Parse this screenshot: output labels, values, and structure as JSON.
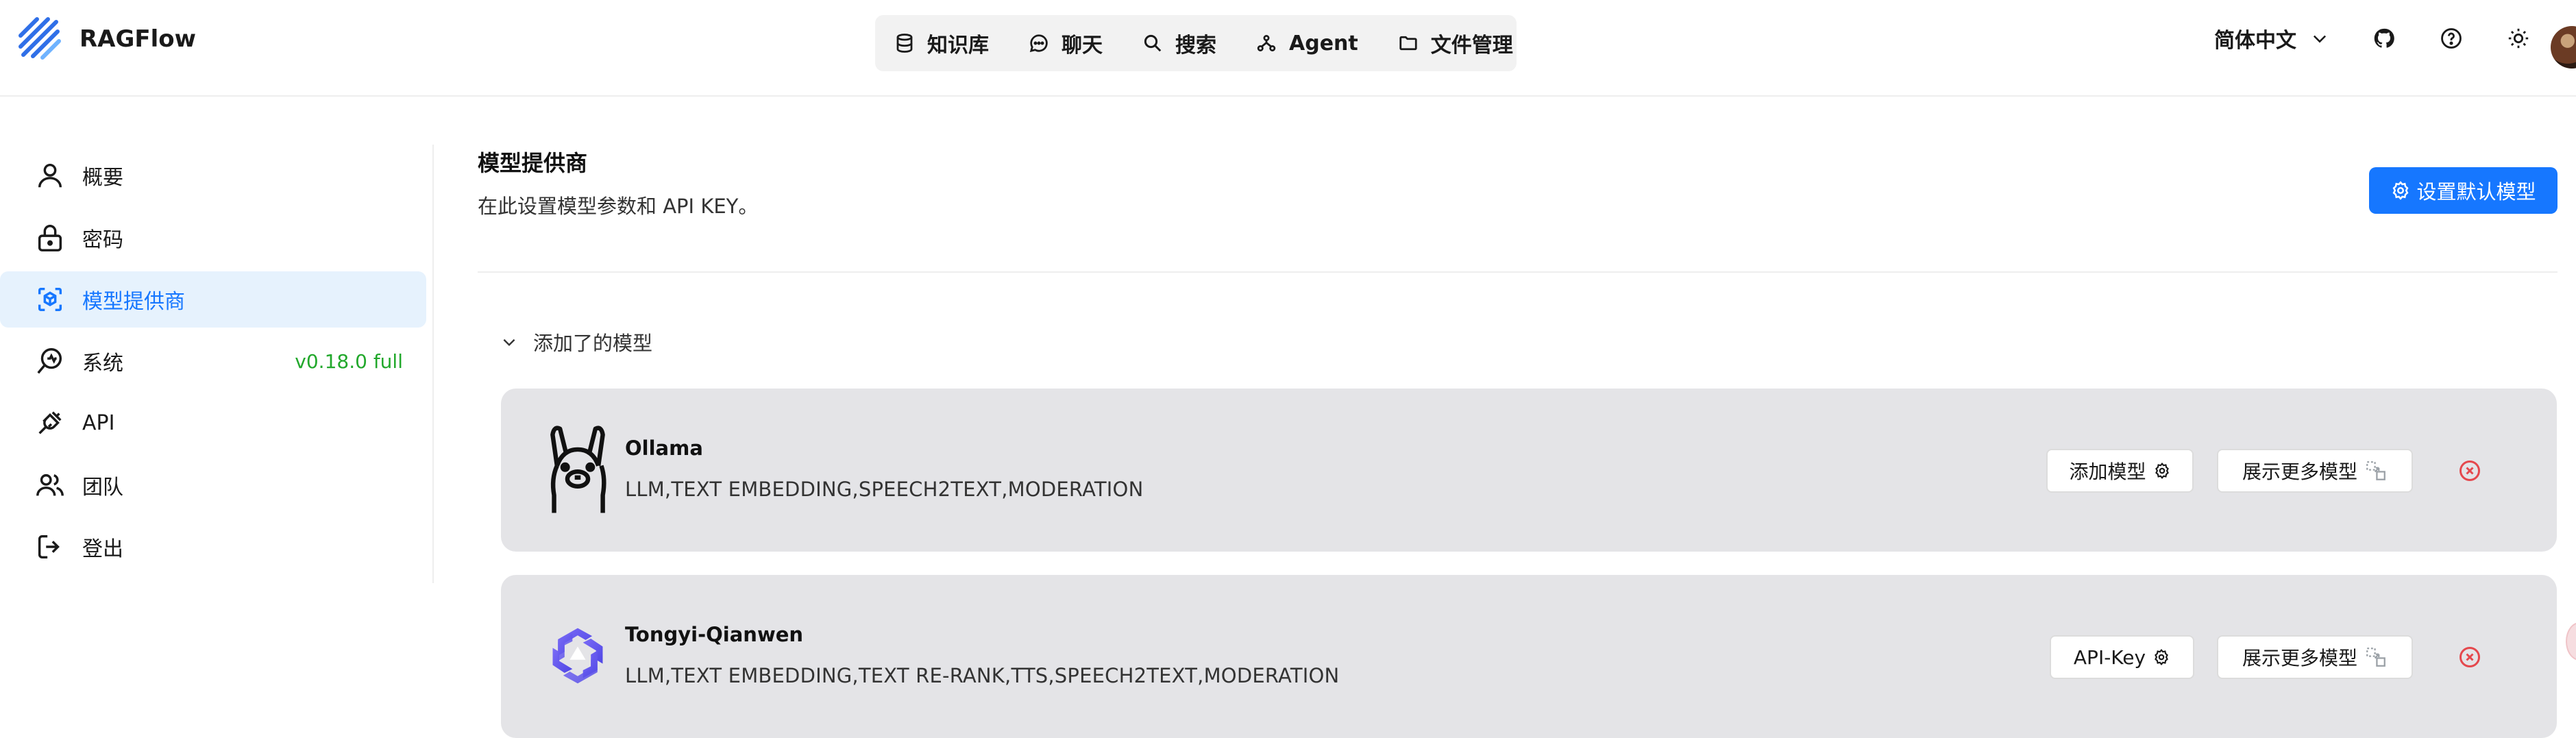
{
  "app": {
    "name": "RAGFlow"
  },
  "nav": {
    "items": [
      {
        "label": "知识库",
        "icon": "database-icon"
      },
      {
        "label": "聊天",
        "icon": "chat-icon"
      },
      {
        "label": "搜索",
        "icon": "search-icon"
      },
      {
        "label": "Agent",
        "icon": "agent-icon"
      },
      {
        "label": "文件管理",
        "icon": "folder-icon"
      }
    ]
  },
  "header": {
    "language": "简体中文",
    "icons": [
      "github-icon",
      "help-icon",
      "theme-sun-icon"
    ]
  },
  "sidebar": {
    "items": [
      {
        "label": "概要",
        "icon": "user-icon"
      },
      {
        "label": "密码",
        "icon": "lock-icon"
      },
      {
        "label": "模型提供商",
        "icon": "model-icon",
        "active": true
      },
      {
        "label": "系统",
        "icon": "system-icon",
        "badge": "v0.18.0 full"
      },
      {
        "label": "API",
        "icon": "plug-icon"
      },
      {
        "label": "团队",
        "icon": "team-icon"
      },
      {
        "label": "登出",
        "icon": "logout-icon"
      }
    ]
  },
  "main": {
    "title": "模型提供商",
    "subtitle": "在此设置模型参数和 API KEY。",
    "default_model_button": "设置默认模型",
    "section_label": "添加了的模型",
    "providers": [
      {
        "name": "Ollama",
        "tags": "LLM,TEXT EMBEDDING,SPEECH2TEXT,MODERATION",
        "primary_button": "添加模型",
        "more_button": "展示更多模型",
        "logo": "ollama-logo-icon"
      },
      {
        "name": "Tongyi-Qianwen",
        "tags": "LLM,TEXT EMBEDDING,TEXT RE-RANK,TTS,SPEECH2TEXT,MODERATION",
        "primary_button": "API-Key",
        "more_button": "展示更多模型",
        "logo": "tongyi-logo-icon"
      }
    ]
  },
  "colors": {
    "accent": "#1677ff",
    "active_bg": "#e6f2fd",
    "version_green": "#22a82c",
    "card_bg": "#e4e4e7",
    "remove_red": "#e5484d"
  }
}
